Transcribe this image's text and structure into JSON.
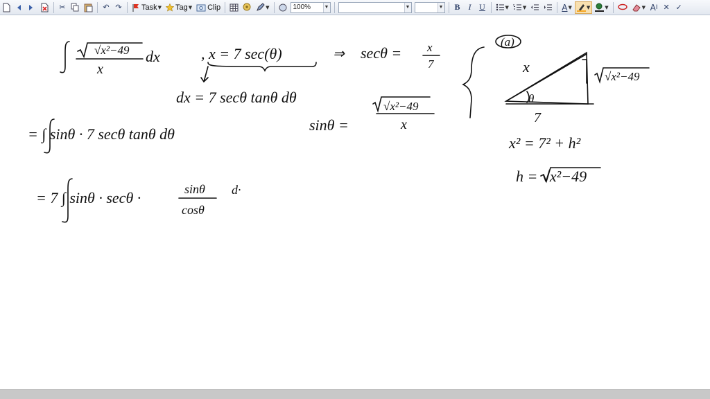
{
  "toolbar": {
    "task_label": "Task",
    "tag_label": "Tag",
    "clip_label": "Clip",
    "zoom_value": "100%",
    "font_name_value": "",
    "font_size_value": "",
    "bold_label": "B",
    "italic_label": "I",
    "underline_label": "U",
    "font_color_label": "A",
    "increase_font_label": "A",
    "highlight_color": "#f5a623",
    "font_color": "#1a1a1a"
  },
  "note": {
    "integral_numerator": "√x²−49",
    "integral_denominator": "x",
    "integral_dx": "dx",
    "substitution": ", x = 7 sec(θ)",
    "implies_1": "⇒",
    "sec_lhs": "secθ =",
    "sec_num": "x",
    "sec_den": "7",
    "dx_line": "dx = 7 secθ tanθ dθ",
    "sin_lhs": "sinθ =",
    "sin_num": "√x²−49",
    "sin_den": "x",
    "step1": "= ∫ sinθ · 7 secθ tanθ dθ",
    "step2_prefix": "= 7 ∫ sinθ · secθ ·",
    "step2_num": "sinθ",
    "step2_den": "cosθ",
    "step2_suffix": "d·",
    "part_label": "(a)",
    "tri_hyp": "x",
    "tri_adj": "7",
    "tri_opp": "√x²−49",
    "tri_angle": "θ",
    "pyth_eq": "x² = 7² + h²",
    "h_eq": "h = √x²−49"
  }
}
